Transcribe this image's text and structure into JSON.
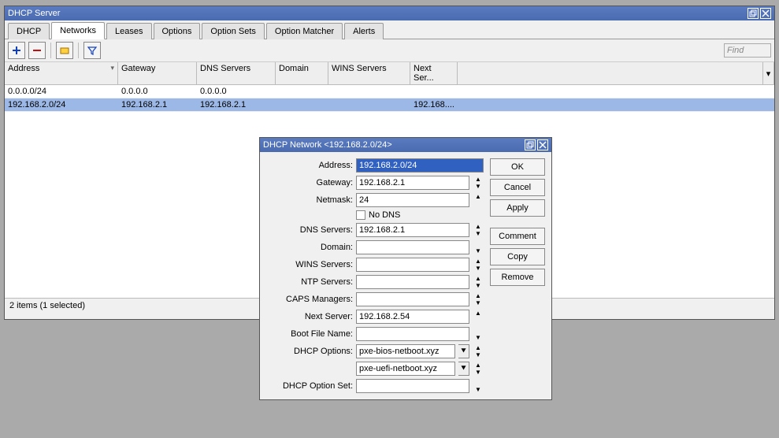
{
  "main_window": {
    "title": "DHCP Server",
    "tabs": [
      "DHCP",
      "Networks",
      "Leases",
      "Options",
      "Option Sets",
      "Option Matcher",
      "Alerts"
    ],
    "active_tab": 1,
    "find_placeholder": "Find",
    "columns": [
      "Address",
      "Gateway",
      "DNS Servers",
      "Domain",
      "WINS Servers",
      "Next Ser..."
    ],
    "rows": [
      {
        "addr": "0.0.0.0/24",
        "gw": "0.0.0.0",
        "dns": "0.0.0.0",
        "dom": "",
        "wins": "",
        "next": ""
      },
      {
        "addr": "192.168.2.0/24",
        "gw": "192.168.2.1",
        "dns": "192.168.2.1",
        "dom": "",
        "wins": "",
        "next": "192.168...."
      }
    ],
    "selected_row": 1,
    "status": "2 items (1 selected)"
  },
  "dialog": {
    "title": "DHCP Network <192.168.2.0/24>",
    "fields": {
      "address_label": "Address:",
      "address": "192.168.2.0/24",
      "gateway_label": "Gateway:",
      "gateway": "192.168.2.1",
      "netmask_label": "Netmask:",
      "netmask": "24",
      "nodns_label": "No DNS",
      "dns_label": "DNS Servers:",
      "dns": "192.168.2.1",
      "domain_label": "Domain:",
      "domain": "",
      "wins_label": "WINS Servers:",
      "wins": "",
      "ntp_label": "NTP Servers:",
      "ntp": "",
      "caps_label": "CAPS Managers:",
      "caps": "",
      "nextsrv_label": "Next Server:",
      "nextsrv": "192.168.2.54",
      "boot_label": "Boot File Name:",
      "boot": "",
      "dhcpopt_label": "DHCP Options:",
      "dhcpopt1": "pxe-bios-netboot.xyz",
      "dhcpopt2": "pxe-uefi-netboot.xyz",
      "optset_label": "DHCP Option Set:",
      "optset": ""
    },
    "buttons": {
      "ok": "OK",
      "cancel": "Cancel",
      "apply": "Apply",
      "comment": "Comment",
      "copy": "Copy",
      "remove": "Remove"
    }
  }
}
